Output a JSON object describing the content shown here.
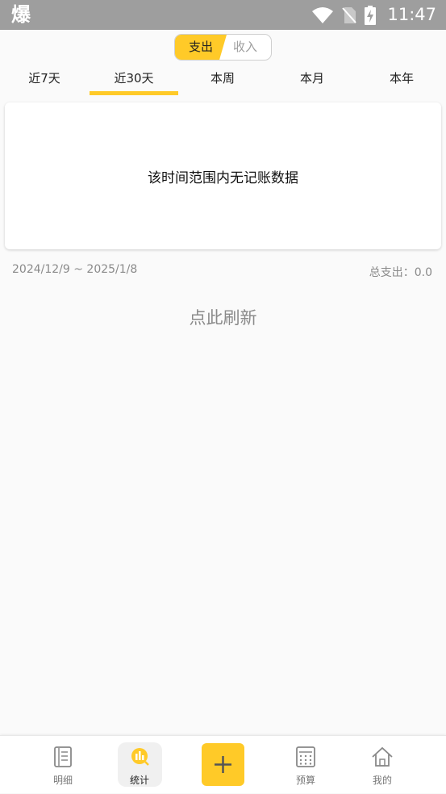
{
  "status_bar": {
    "app_icon_text": "爆",
    "time": "11:47"
  },
  "segment": {
    "active": "支出",
    "inactive": "收入"
  },
  "tabs": [
    {
      "label": "近7天",
      "active": false
    },
    {
      "label": "近30天",
      "active": true
    },
    {
      "label": "本周",
      "active": false
    },
    {
      "label": "本月",
      "active": false
    },
    {
      "label": "本年",
      "active": false
    }
  ],
  "chart_card": {
    "empty_message": "该时间范围内无记账数据"
  },
  "summary": {
    "date_range": "2024/12/9 ~ 2025/1/8",
    "total_label": "总支出：0.0"
  },
  "refresh_text": "点此刷新",
  "bottom_nav": [
    {
      "label": "明细",
      "icon": "list-icon"
    },
    {
      "label": "统计",
      "icon": "stats-icon",
      "active": true
    },
    {
      "label": "",
      "icon": "plus-icon"
    },
    {
      "label": "预算",
      "icon": "calculator-icon"
    },
    {
      "label": "我的",
      "icon": "home-icon"
    }
  ],
  "colors": {
    "accent": "#ffca28",
    "status_bar": "#9e9e9e",
    "muted_text": "#8a8a8a"
  }
}
